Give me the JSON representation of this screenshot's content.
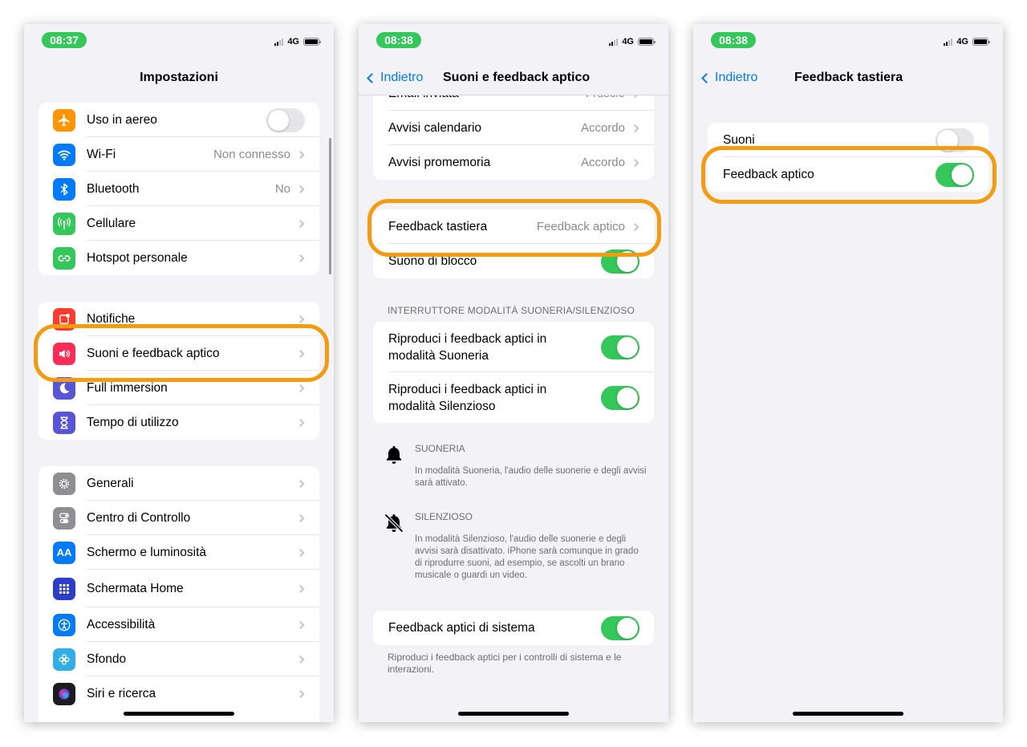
{
  "colors": {
    "accent": "#007aff",
    "toggle_on": "#34c759",
    "highlight": "#f39c12"
  },
  "status": {
    "network": "4G"
  },
  "screen1": {
    "time": "08:37",
    "title": "Impostazioni",
    "group1": [
      {
        "label": "Uso in aereo",
        "icon": "airplane-icon",
        "color": "#ff9500",
        "toggle": false
      },
      {
        "label": "Wi-Fi",
        "value": "Non connesso",
        "icon": "wifi-icon",
        "color": "#007aff"
      },
      {
        "label": "Bluetooth",
        "value": "No",
        "icon": "bluetooth-icon",
        "color": "#007aff"
      },
      {
        "label": "Cellulare",
        "icon": "antenna-icon",
        "color": "#34c759"
      },
      {
        "label": "Hotspot personale",
        "icon": "hotspot-icon",
        "color": "#34c759"
      }
    ],
    "group2": [
      {
        "label": "Notifiche",
        "icon": "bell-icon",
        "color": "#ff3b30"
      },
      {
        "label": "Suoni e feedback aptico",
        "icon": "speaker-icon",
        "color": "#ff2d55"
      },
      {
        "label": "Full immersion",
        "icon": "moon-icon",
        "color": "#5856d6"
      },
      {
        "label": "Tempo di utilizzo",
        "icon": "hourglass-icon",
        "color": "#5856d6"
      }
    ],
    "group3": [
      {
        "label": "Generali",
        "icon": "gear-icon",
        "color": "#8e8e93"
      },
      {
        "label": "Centro di Controllo",
        "icon": "switches-icon",
        "color": "#8e8e93"
      },
      {
        "label": "Schermo e luminosità",
        "icon": "text-size-icon",
        "color": "#007aff",
        "glyph": "AA"
      },
      {
        "label": "Schermata Home",
        "icon": "home-grid-icon",
        "color": "#2c3ec7"
      },
      {
        "label": "Accessibilità",
        "icon": "accessibility-icon",
        "color": "#007aff"
      },
      {
        "label": "Sfondo",
        "icon": "flower-icon",
        "color": "#32ade6"
      },
      {
        "label": "Siri e ricerca",
        "icon": "siri-icon",
        "color": "#1c1c1e"
      }
    ]
  },
  "screen2": {
    "time": "08:38",
    "back": "Indietro",
    "title": "Suoni e feedback aptico",
    "group1": [
      {
        "label": "Email inviata",
        "value": "Fruscio"
      },
      {
        "label": "Avvisi calendario",
        "value": "Accordo"
      },
      {
        "label": "Avvisi promemoria",
        "value": "Accordo"
      }
    ],
    "group2": [
      {
        "label": "Feedback tastiera",
        "value": "Feedback aptico"
      },
      {
        "label": "Suono di blocco",
        "toggle": true
      }
    ],
    "section_header": "INTERRUTTORE MODALITÀ SUONERIA/SILENZIOSO",
    "group3": [
      {
        "line1": "Riproduci i feedback aptici in",
        "line2": "modalità Suoneria",
        "toggle": true
      },
      {
        "line1": "Riproduci i feedback aptici in",
        "line2": "modalità Silenzioso",
        "toggle": true
      }
    ],
    "info": [
      {
        "title": "SUONERIA",
        "text": "In modalità Suoneria, l'audio delle suonerie e degli avvisi sarà attivato.",
        "icon": "bell-icon"
      },
      {
        "title": "SILENZIOSO",
        "text": "In modalità Silenzioso, l'audio delle suonerie e degli avvisi sarà disattivato. iPhone sarà comunque in grado di riprodurre suoni, ad esempio, se ascolti un brano musicale o guardi un video.",
        "icon": "bell-slash-icon"
      }
    ],
    "group4": {
      "label": "Feedback aptici di sistema",
      "toggle": true
    },
    "footnote": "Riproduci i feedback aptici per i controlli di sistema e le interazioni."
  },
  "screen3": {
    "time": "08:38",
    "back": "Indietro",
    "title": "Feedback tastiera",
    "rows": [
      {
        "label": "Suoni",
        "toggle": false
      },
      {
        "label": "Feedback aptico",
        "toggle": true
      }
    ]
  }
}
